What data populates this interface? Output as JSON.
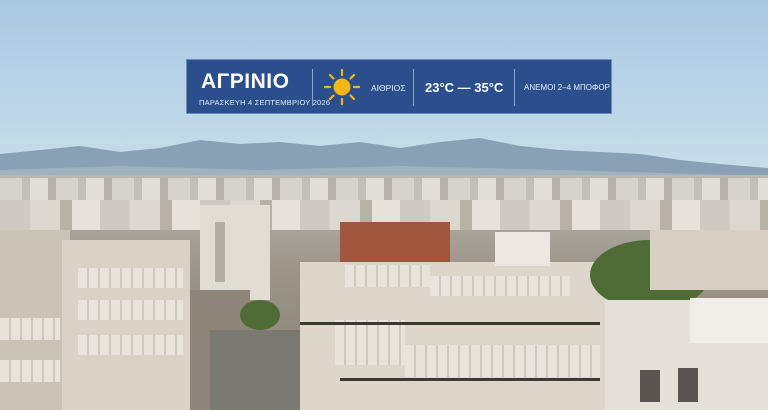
{
  "weather": {
    "city": "ΑΓΡΙΝΙΟ",
    "date": "ΠΑΡΑΣΚΕΥΗ 4 ΣΕΠΤΕΜΒΡΙΟΥ 2026",
    "condition_icon": "sun-icon",
    "condition": "ΑΙΘΡΙΟΣ",
    "temperature": "23°C — 35°C",
    "wind": "ΑΝΕΜΟΙ 2–4 ΜΠΟΦΟΡ"
  },
  "colors": {
    "banner_bg": "#2a4f8c",
    "sun": "#f2b716"
  }
}
